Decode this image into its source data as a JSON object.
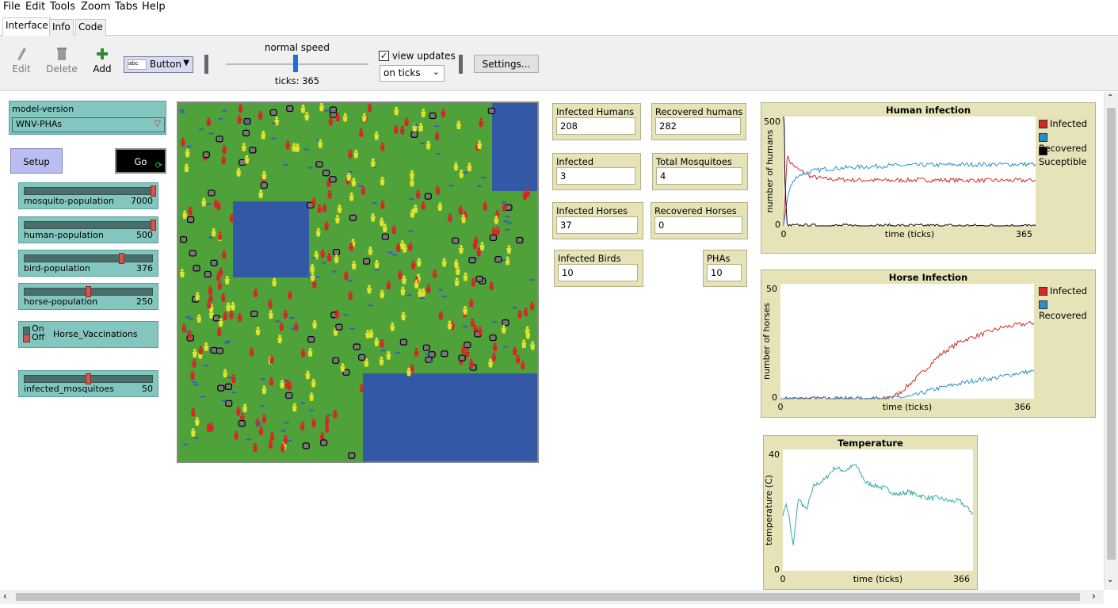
{
  "menu": [
    "File",
    "Edit",
    "Tools",
    "Zoom",
    "Tabs",
    "Help"
  ],
  "tabs": [
    "Interface",
    "Info",
    "Code"
  ],
  "toolbar": {
    "edit_label": "Edit",
    "delete_label": "Delete",
    "add_label": "Add",
    "widget_type": "Button",
    "speed_label": "normal speed",
    "ticks_label": "ticks: 365",
    "view_updates_label": "view updates",
    "view_updates_checked": true,
    "update_mode": "on ticks",
    "settings_label": "Settings..."
  },
  "chooser": {
    "label": "model-version",
    "value": "WNV-PHAs"
  },
  "buttons": {
    "setup": "Setup",
    "go": "Go"
  },
  "sliders": [
    {
      "name": "mosquito-population",
      "value": "7000",
      "fraction": 1.0
    },
    {
      "name": "human-population",
      "value": "500",
      "fraction": 1.0
    },
    {
      "name": "bird-population",
      "value": "376",
      "fraction": 0.75
    },
    {
      "name": "horse-population",
      "value": "250",
      "fraction": 0.5
    },
    {
      "name": "infected_mosquitoes",
      "value": "50",
      "fraction": 0.5
    }
  ],
  "switch": {
    "on": "On",
    "off": "Off",
    "label": "Horse_Vaccinations"
  },
  "monitors": [
    {
      "label": "Infected Humans",
      "value": "208"
    },
    {
      "label": "Recovered humans",
      "value": "282"
    },
    {
      "label": "Infected Mosquitoes",
      "value": "3"
    },
    {
      "label": "Total Mosquitoes",
      "value": "4"
    },
    {
      "label": "Infected Horses",
      "value": "37"
    },
    {
      "label": "Recovered Horses",
      "value": "0"
    },
    {
      "label": "Infected Birds",
      "value": "10"
    },
    {
      "label": "PHAs",
      "value": "10"
    }
  ],
  "colors": {
    "grass": "#4fa23a",
    "water": "#3359a6",
    "infected": "#d62728",
    "recovered": "#2a8fc7",
    "susceptible": "#000000",
    "temperature": "#3aa9a9"
  },
  "chart_data": [
    {
      "type": "line",
      "title": "Human infection",
      "xlabel": "time (ticks)",
      "ylabel": "number of humans",
      "xlim": [
        0,
        365
      ],
      "ylim": [
        0,
        500
      ],
      "series": [
        {
          "name": "Infected",
          "x": [
            0,
            5,
            10,
            20,
            40,
            60,
            100,
            150,
            200,
            250,
            300,
            365
          ],
          "values": [
            0,
            320,
            290,
            260,
            225,
            215,
            210,
            208,
            210,
            209,
            208,
            208
          ]
        },
        {
          "name": "Recovered",
          "x": [
            0,
            5,
            10,
            20,
            40,
            60,
            100,
            150,
            200,
            250,
            300,
            365
          ],
          "values": [
            0,
            120,
            180,
            230,
            250,
            260,
            268,
            275,
            278,
            280,
            281,
            282
          ]
        },
        {
          "name": "Suceptible",
          "x": [
            0,
            1,
            2,
            5,
            365
          ],
          "values": [
            500,
            450,
            200,
            0,
            0
          ]
        }
      ]
    },
    {
      "type": "line",
      "title": "Horse Infection",
      "xlabel": "time (ticks)",
      "ylabel": "number of horses",
      "xlim": [
        0,
        366
      ],
      "ylim": [
        0,
        50
      ],
      "series": [
        {
          "name": "Infected",
          "x": [
            0,
            50,
            100,
            150,
            170,
            200,
            230,
            260,
            290,
            320,
            340,
            366
          ],
          "values": [
            0,
            0,
            0,
            0,
            2,
            10,
            19,
            25,
            28,
            31,
            32,
            33
          ]
        },
        {
          "name": "Recovered",
          "x": [
            0,
            50,
            100,
            150,
            190,
            220,
            250,
            280,
            310,
            340,
            366
          ],
          "values": [
            0,
            0,
            0,
            0,
            1,
            4,
            6,
            8,
            9,
            11,
            12
          ]
        }
      ]
    },
    {
      "type": "line",
      "title": "Temperature",
      "xlabel": "time (ticks)",
      "ylabel": "temperature (C)",
      "xlim": [
        0,
        366
      ],
      "ylim": [
        0,
        40
      ],
      "series": [
        {
          "name": "",
          "x": [
            0,
            5,
            10,
            20,
            30,
            45,
            60,
            80,
            100,
            120,
            140,
            160,
            180,
            200,
            220,
            240,
            260,
            280,
            300,
            320,
            340,
            366
          ],
          "values": [
            18,
            22,
            20,
            8,
            24,
            20,
            28,
            30,
            34,
            33,
            35,
            29,
            28,
            27,
            25,
            26,
            25,
            24,
            24,
            23,
            23,
            19
          ]
        }
      ]
    }
  ]
}
